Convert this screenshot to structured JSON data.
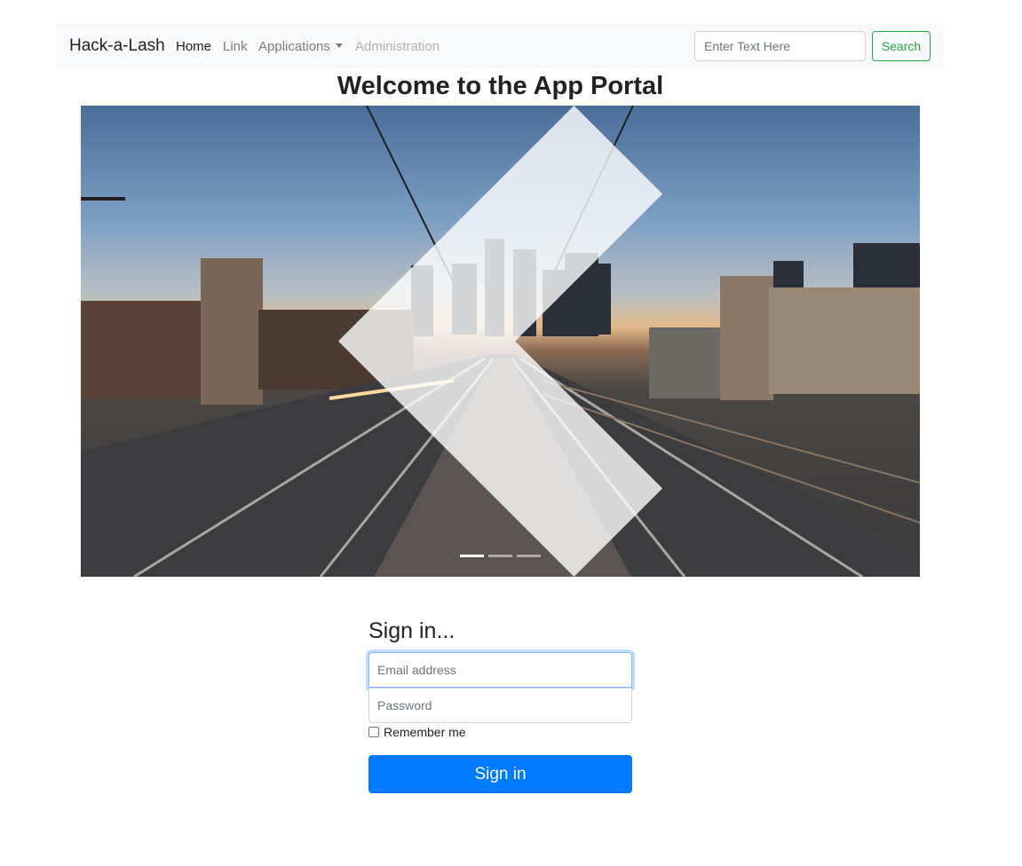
{
  "navbar": {
    "brand": "Hack-a-Lash",
    "links": {
      "home": "Home",
      "link": "Link",
      "applications": "Applications",
      "administration": "Administration"
    },
    "search": {
      "placeholder": "Enter Text Here",
      "button": "Search"
    }
  },
  "page": {
    "title": "Welcome to the App Portal"
  },
  "carousel": {
    "image_icon": "city-street-railway-photo",
    "prev_icon": "chevron-left-icon",
    "next_icon": "chevron-right-icon",
    "slide_count": 3,
    "active_slide": 1
  },
  "signin": {
    "heading": "Sign in...",
    "email_placeholder": "Email address",
    "password_placeholder": "Password",
    "remember_label": "Remember me",
    "remember_checked": false,
    "button": "Sign in"
  },
  "colors": {
    "primary": "#007bff",
    "success": "#28a745",
    "navbar_bg": "#f8f9fa"
  }
}
